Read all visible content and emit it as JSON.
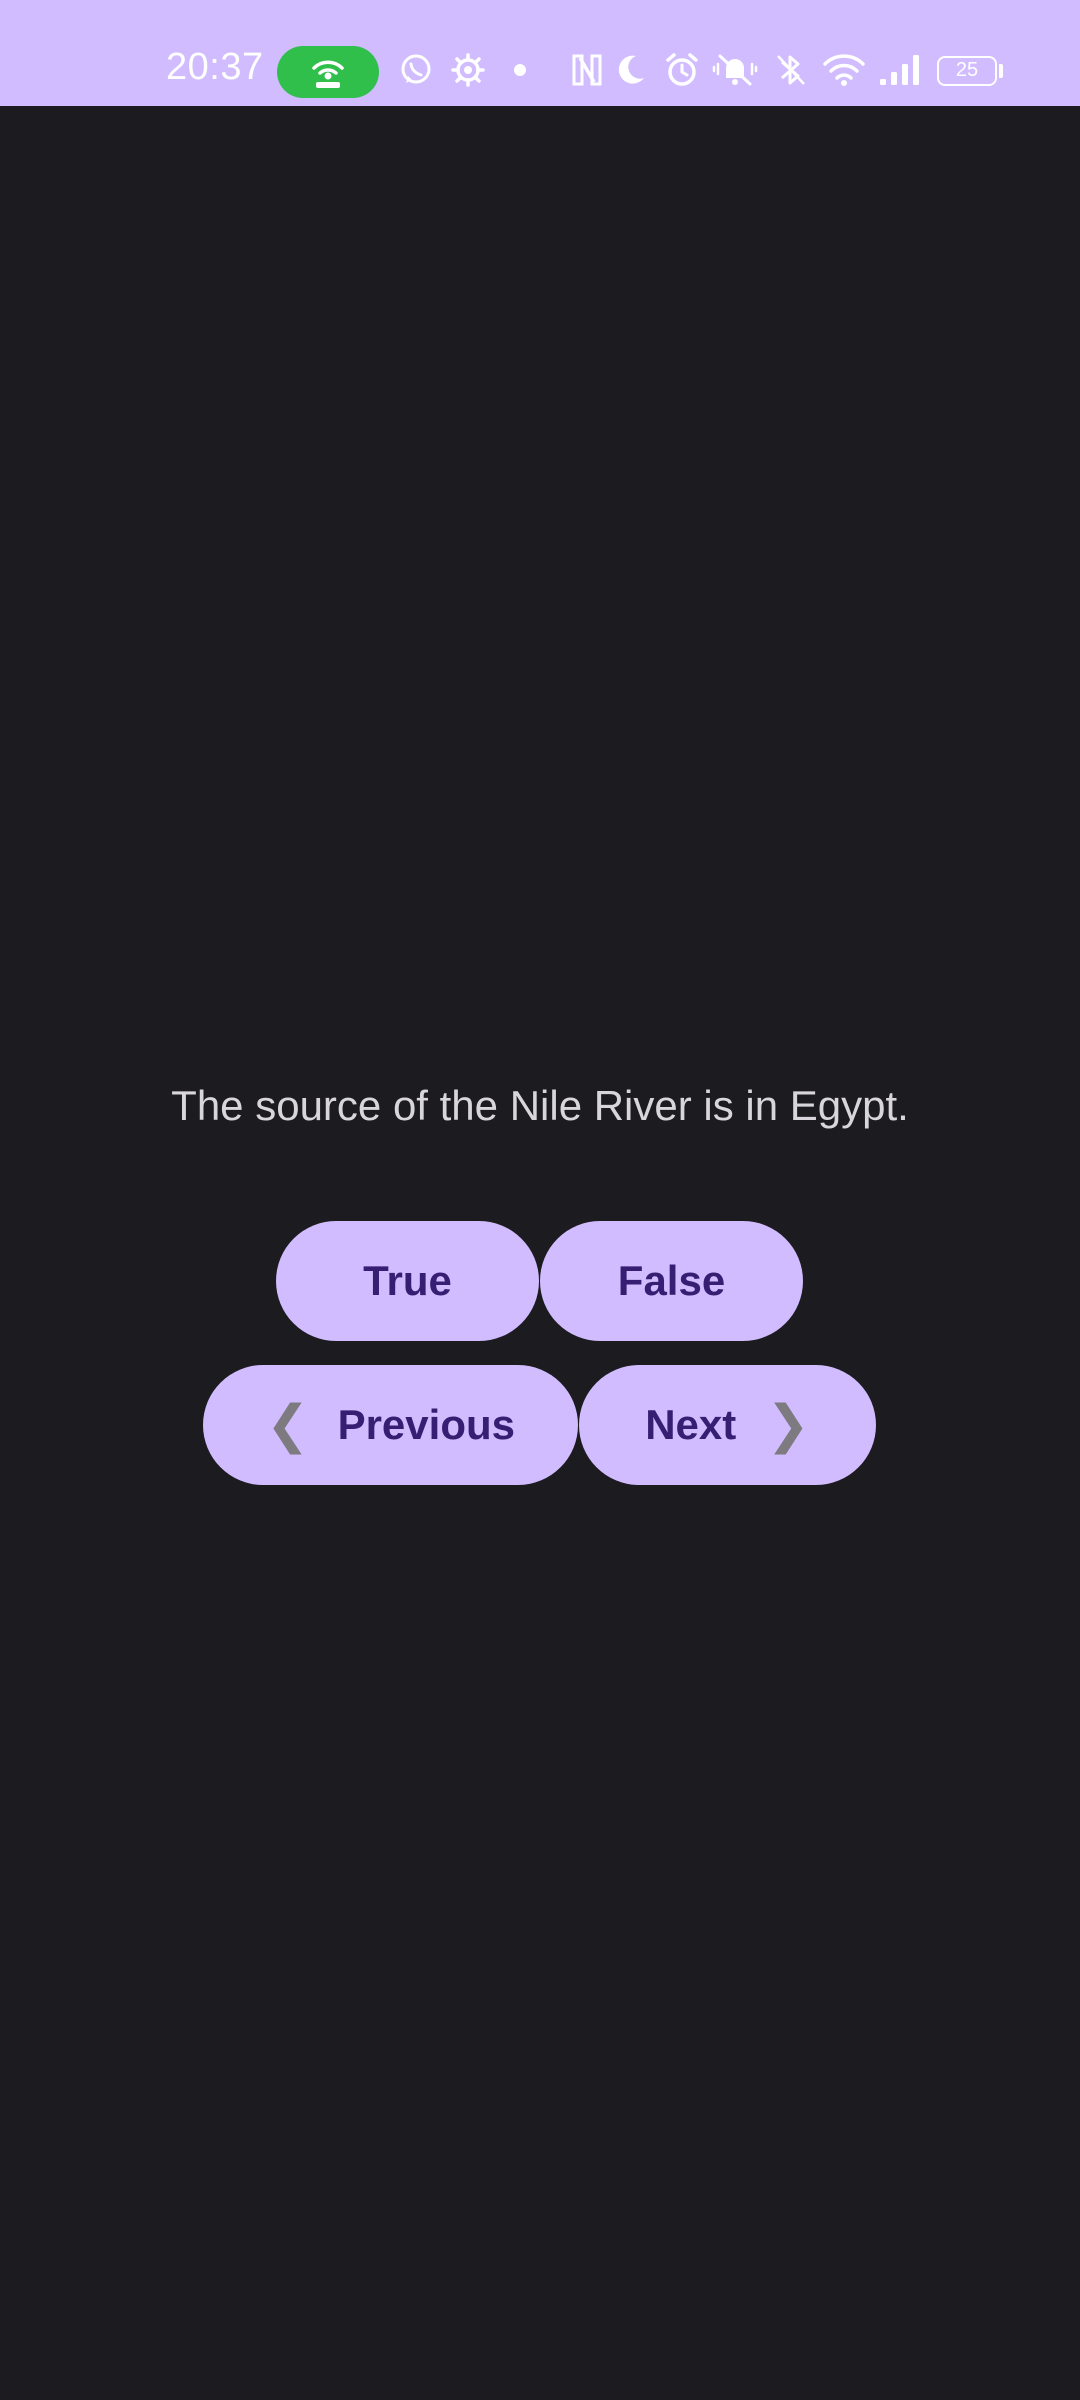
{
  "status_bar": {
    "time": "20:37",
    "battery_level": "25",
    "icons": [
      "hotspot-icon",
      "whatsapp-icon",
      "settings-gear-icon",
      "dot-icon",
      "nfc-icon",
      "moon-icon",
      "alarm-icon",
      "vibrate-off-icon",
      "bluetooth-icon",
      "wifi-icon",
      "signal-icon",
      "battery-icon"
    ]
  },
  "quiz": {
    "question": "The source of the Nile River is in Egypt.",
    "true_label": "True",
    "false_label": "False",
    "previous_label": "Previous",
    "next_label": "Next",
    "previous_chevron": "❮",
    "next_chevron": "❯"
  },
  "colors": {
    "accent": "#d0bcfe",
    "on_accent": "#381e72",
    "background": "#1c1b1f",
    "hotspot_pill": "#2fbf4a"
  }
}
